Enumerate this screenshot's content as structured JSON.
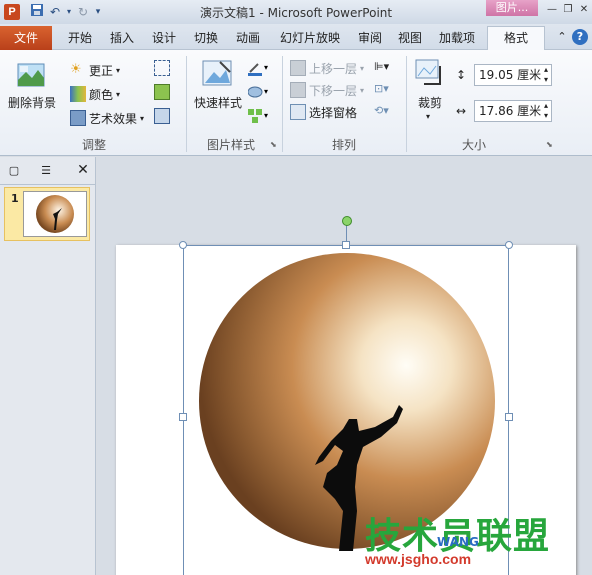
{
  "titlebar": {
    "app_icon": "P",
    "title": "演示文稿1 - Microsoft PowerPoint",
    "context_tab_label": "图片...",
    "icons": [
      "save-icon",
      "undo-icon",
      "redo-icon",
      "customize-qat-icon"
    ]
  },
  "tabs": {
    "file": "文件",
    "items": [
      "开始",
      "插入",
      "设计",
      "切换",
      "动画",
      "幻灯片放映",
      "审阅",
      "视图",
      "加载项"
    ],
    "active": "格式"
  },
  "ribbon": {
    "adjust": {
      "remove_bg": "删除背景",
      "corrections": "更正",
      "color": "颜色",
      "artistic": "艺术效果",
      "group": "调整"
    },
    "styles": {
      "quick_styles": "快速样式",
      "group": "图片样式"
    },
    "arrange": {
      "bring_forward": "上移一层",
      "send_backward": "下移一层",
      "selection_pane": "选择窗格",
      "group": "排列"
    },
    "size": {
      "crop": "裁剪",
      "height": "19.05 厘米",
      "width": "17.86 厘米",
      "group": "大小"
    }
  },
  "slides_pane": {
    "slide_number": "1",
    "close_glyph": "✕"
  },
  "watermark": {
    "line1": "技术员联盟",
    "line2": "www.jsgho.com",
    "line3": "WANG"
  },
  "colors": {
    "file_tab": "#c8471e",
    "context_tab": "#cf74a6",
    "selection": "#6f8fb5",
    "rotate_handle": "#8bd46a",
    "watermark_green": "#27a63c"
  }
}
